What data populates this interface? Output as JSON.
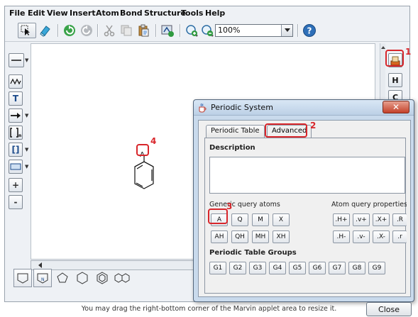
{
  "menus": [
    "File",
    "Edit",
    "View",
    "Insert",
    "Atom",
    "Bond",
    "Structure",
    "Tools",
    "Help"
  ],
  "zoom": {
    "value": "100%"
  },
  "left_tools": {
    "text_tool": "T",
    "bracket_tool": "[]",
    "plus": "+",
    "minus": "-"
  },
  "right_tools": {
    "h_atom": "H",
    "c_atom": "C"
  },
  "canvas": {
    "atom_label": "A"
  },
  "dialog": {
    "title": "Periodic System",
    "tabs": [
      "Periodic Table",
      "Advanced"
    ],
    "description_label": "Description",
    "generic_query_label": "Generic query atoms",
    "atom_query_label": "Atom query properties",
    "generic_row1": [
      "A",
      "Q",
      "M",
      "X"
    ],
    "generic_row2": [
      "AH",
      "QH",
      "MH",
      "XH"
    ],
    "prop_row1": [
      ".H+",
      ".v+",
      ".X+",
      ".R"
    ],
    "prop_row2": [
      ".H-",
      ".v-",
      ".X-",
      ".r"
    ],
    "groups_label": "Periodic Table Groups",
    "groups": [
      "G1",
      "G2",
      "G3",
      "G4",
      "G5",
      "G6",
      "G7",
      "G8",
      "G9"
    ],
    "close_label": "Close"
  },
  "callouts": [
    "1",
    "2",
    "3",
    "4"
  ],
  "caption": "You may drag the right-bottom corner of the Marvin applet area to resize it.",
  "colors": {
    "callout_red": "#d8262b",
    "dialog_frame": "#c9daec",
    "close_x": "#c4412a"
  }
}
